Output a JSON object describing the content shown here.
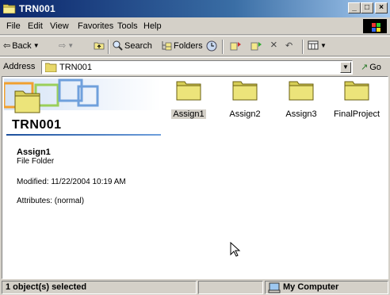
{
  "window": {
    "title": "TRN001"
  },
  "title_buttons": {
    "minimize": "_",
    "maximize": "□",
    "close": "×"
  },
  "menu": [
    "File",
    "Edit",
    "View",
    "Favorites",
    "Tools",
    "Help"
  ],
  "toolbar": {
    "back": "Back",
    "search": "Search",
    "folders": "Folders"
  },
  "address": {
    "label": "Address",
    "value": "TRN001",
    "go": "Go"
  },
  "folder_panel": {
    "name": "TRN001",
    "selected_name": "Assign1",
    "selected_type": "File Folder",
    "modified": "Modified: 11/22/2004 10:19 AM",
    "attributes": "Attributes: (normal)"
  },
  "items": [
    {
      "label": "Assign1",
      "selected": true
    },
    {
      "label": "Assign2",
      "selected": false
    },
    {
      "label": "Assign3",
      "selected": false
    },
    {
      "label": "FinalProject",
      "selected": false
    }
  ],
  "status": {
    "selection": "1 object(s) selected",
    "zone": "My Computer"
  },
  "colors": {
    "title_start": "#0a246a",
    "title_end": "#a6caf0",
    "folder_fill": "#e8e474",
    "chrome": "#d4d0c8"
  }
}
